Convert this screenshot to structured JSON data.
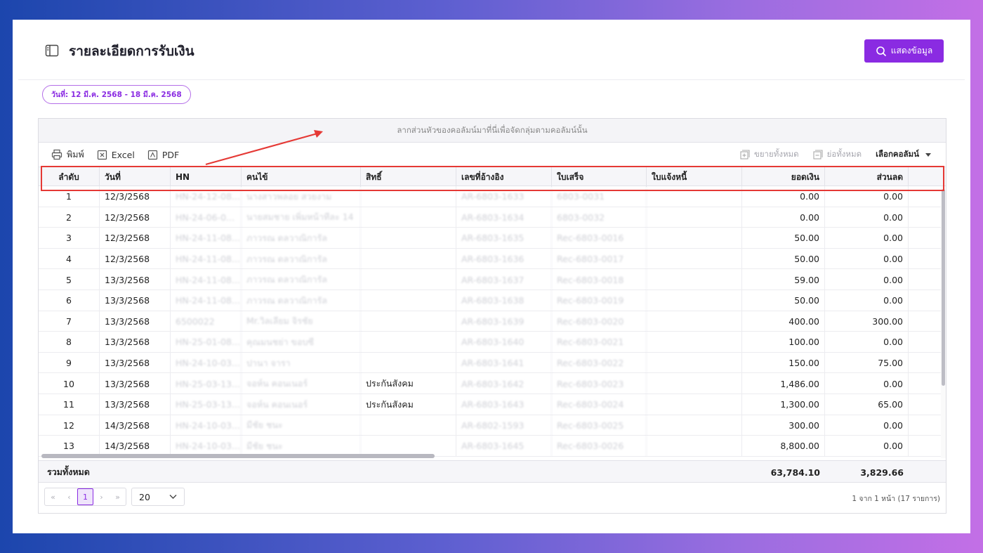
{
  "header": {
    "title": "รายละเอียดการรับเงิน",
    "show_button": "แสดงข้อมูล"
  },
  "date_range": "วันที่: 12 มี.ค. 2568 - 18 มี.ค. 2568",
  "group_panel_text": "ลากส่วนหัวของคอลัมน์มาที่นี่เพื่อจัดกลุ่มตามคอลัมน์นั้น",
  "toolbar": {
    "print": "พิมพ์",
    "excel": "Excel",
    "pdf": "PDF",
    "expand_all": "ขยายทั้งหมด",
    "collapse_all": "ย่อทั้งหมด",
    "choose_columns": "เลือกคอลัมน์"
  },
  "columns": [
    "ลำดับ",
    "วันที่",
    "HN",
    "คนไข้",
    "สิทธิ์",
    "เลขที่อ้างอิง",
    "ใบเสร็จ",
    "ใบแจ้งหนี้",
    "ยอดเงิน",
    "ส่วนลด"
  ],
  "rows": [
    {
      "no": "1",
      "date": "12/3/2568",
      "hn": "HN-24-12-08...",
      "patient": "นางสาวพลอย สวยงาม",
      "right": "",
      "ref": "AR-6803-1633",
      "receipt": "6803-0031",
      "invoice": "",
      "amount": "0.00",
      "discount": "0.00"
    },
    {
      "no": "2",
      "date": "12/3/2568",
      "hn": "HN-24-06-0...",
      "patient": "นายสมชาย เพิ่มหน้าทีละ 14",
      "right": "",
      "ref": "AR-6803-1634",
      "receipt": "6803-0032",
      "invoice": "",
      "amount": "0.00",
      "discount": "0.00"
    },
    {
      "no": "3",
      "date": "12/3/2568",
      "hn": "HN-24-11-08...",
      "patient": "ภาวรณ ดลวาณิการัล",
      "right": "",
      "ref": "AR-6803-1635",
      "receipt": "Rec-6803-0016",
      "invoice": "",
      "amount": "50.00",
      "discount": "0.00"
    },
    {
      "no": "4",
      "date": "12/3/2568",
      "hn": "HN-24-11-08...",
      "patient": "ภาวรณ ดลวาณิการัล",
      "right": "",
      "ref": "AR-6803-1636",
      "receipt": "Rec-6803-0017",
      "invoice": "",
      "amount": "50.00",
      "discount": "0.00"
    },
    {
      "no": "5",
      "date": "13/3/2568",
      "hn": "HN-24-11-08...",
      "patient": "ภาวรณ ดลวาณิการัล",
      "right": "",
      "ref": "AR-6803-1637",
      "receipt": "Rec-6803-0018",
      "invoice": "",
      "amount": "59.00",
      "discount": "0.00"
    },
    {
      "no": "6",
      "date": "13/3/2568",
      "hn": "HN-24-11-08...",
      "patient": "ภาวรณ ดลวาณิการัล",
      "right": "",
      "ref": "AR-6803-1638",
      "receipt": "Rec-6803-0019",
      "invoice": "",
      "amount": "50.00",
      "discount": "0.00"
    },
    {
      "no": "7",
      "date": "13/3/2568",
      "hn": "6500022",
      "patient": "Mr.วิลเลียม จิรชัย",
      "right": "",
      "ref": "AR-6803-1639",
      "receipt": "Rec-6803-0020",
      "invoice": "",
      "amount": "400.00",
      "discount": "300.00"
    },
    {
      "no": "8",
      "date": "13/3/2568",
      "hn": "HN-25-01-08...",
      "patient": "คุณมนชย่า ขอบซี",
      "right": "",
      "ref": "AR-6803-1640",
      "receipt": "Rec-6803-0021",
      "invoice": "",
      "amount": "100.00",
      "discount": "0.00"
    },
    {
      "no": "9",
      "date": "13/3/2568",
      "hn": "HN-24-10-03...",
      "patient": "ปานา จารา",
      "right": "",
      "ref": "AR-6803-1641",
      "receipt": "Rec-6803-0022",
      "invoice": "",
      "amount": "150.00",
      "discount": "75.00"
    },
    {
      "no": "10",
      "date": "13/3/2568",
      "hn": "HN-25-03-13...",
      "patient": "จอห์น คอนเนอร์",
      "right": "ประกันสังคม",
      "ref": "AR-6803-1642",
      "receipt": "Rec-6803-0023",
      "invoice": "",
      "amount": "1,486.00",
      "discount": "0.00"
    },
    {
      "no": "11",
      "date": "13/3/2568",
      "hn": "HN-25-03-13...",
      "patient": "จอห์น คอนเนอร์",
      "right": "ประกันสังคม",
      "ref": "AR-6803-1643",
      "receipt": "Rec-6803-0024",
      "invoice": "",
      "amount": "1,300.00",
      "discount": "65.00"
    },
    {
      "no": "12",
      "date": "14/3/2568",
      "hn": "HN-24-10-03...",
      "patient": "มีชัย ชนะ",
      "right": "",
      "ref": "AR-6802-1593",
      "receipt": "Rec-6803-0025",
      "invoice": "",
      "amount": "300.00",
      "discount": "0.00"
    },
    {
      "no": "13",
      "date": "14/3/2568",
      "hn": "HN-24-10-03...",
      "patient": "มีชัย ชนะ",
      "right": "",
      "ref": "AR-6803-1645",
      "receipt": "Rec-6803-0026",
      "invoice": "",
      "amount": "8,800.00",
      "discount": "0.00"
    }
  ],
  "footer": {
    "label": "รวมทั้งหมด",
    "total_amount": "63,784.10",
    "total_discount": "3,829.66"
  },
  "pager": {
    "first": "«",
    "prev": "‹",
    "current": "1",
    "next": "›",
    "last": "»",
    "page_size": "20",
    "info": "1 จาก 1 หน้า (17 รายการ)"
  },
  "colors": {
    "accent": "#8a2be2",
    "highlight": "#e53935"
  }
}
